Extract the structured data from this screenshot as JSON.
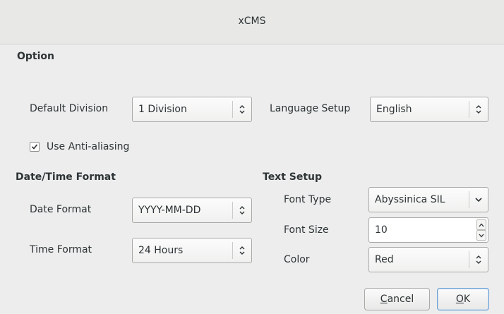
{
  "window": {
    "title": "xCMS"
  },
  "option": {
    "heading": "Option",
    "default_division_label": "Default Division",
    "default_division_value": "1 Division",
    "language_label": "Language Setup",
    "language_value": "English",
    "anti_aliasing_label": "Use Anti-aliasing",
    "anti_aliasing_checked": true
  },
  "datetime": {
    "heading": "Date/Time Format",
    "date_label": "Date Format",
    "date_value": "YYYY-MM-DD",
    "time_label": "Time Format",
    "time_value": "24 Hours"
  },
  "text_setup": {
    "heading": "Text Setup",
    "font_type_label": "Font Type",
    "font_type_value": "Abyssinica SIL",
    "font_size_label": "Font Size",
    "font_size_value": "10",
    "color_label": "Color",
    "color_value": "Red"
  },
  "buttons": {
    "cancel_first": "C",
    "cancel_rest": "ancel",
    "ok_first": "O",
    "ok_rest": "K"
  },
  "icons": {
    "combo_arrow": "updown-chevron-icon",
    "dropdown_arrow": "chevron-down-icon",
    "spin_up": "spin-up-icon",
    "spin_down": "spin-down-icon",
    "check": "checkmark-icon"
  }
}
